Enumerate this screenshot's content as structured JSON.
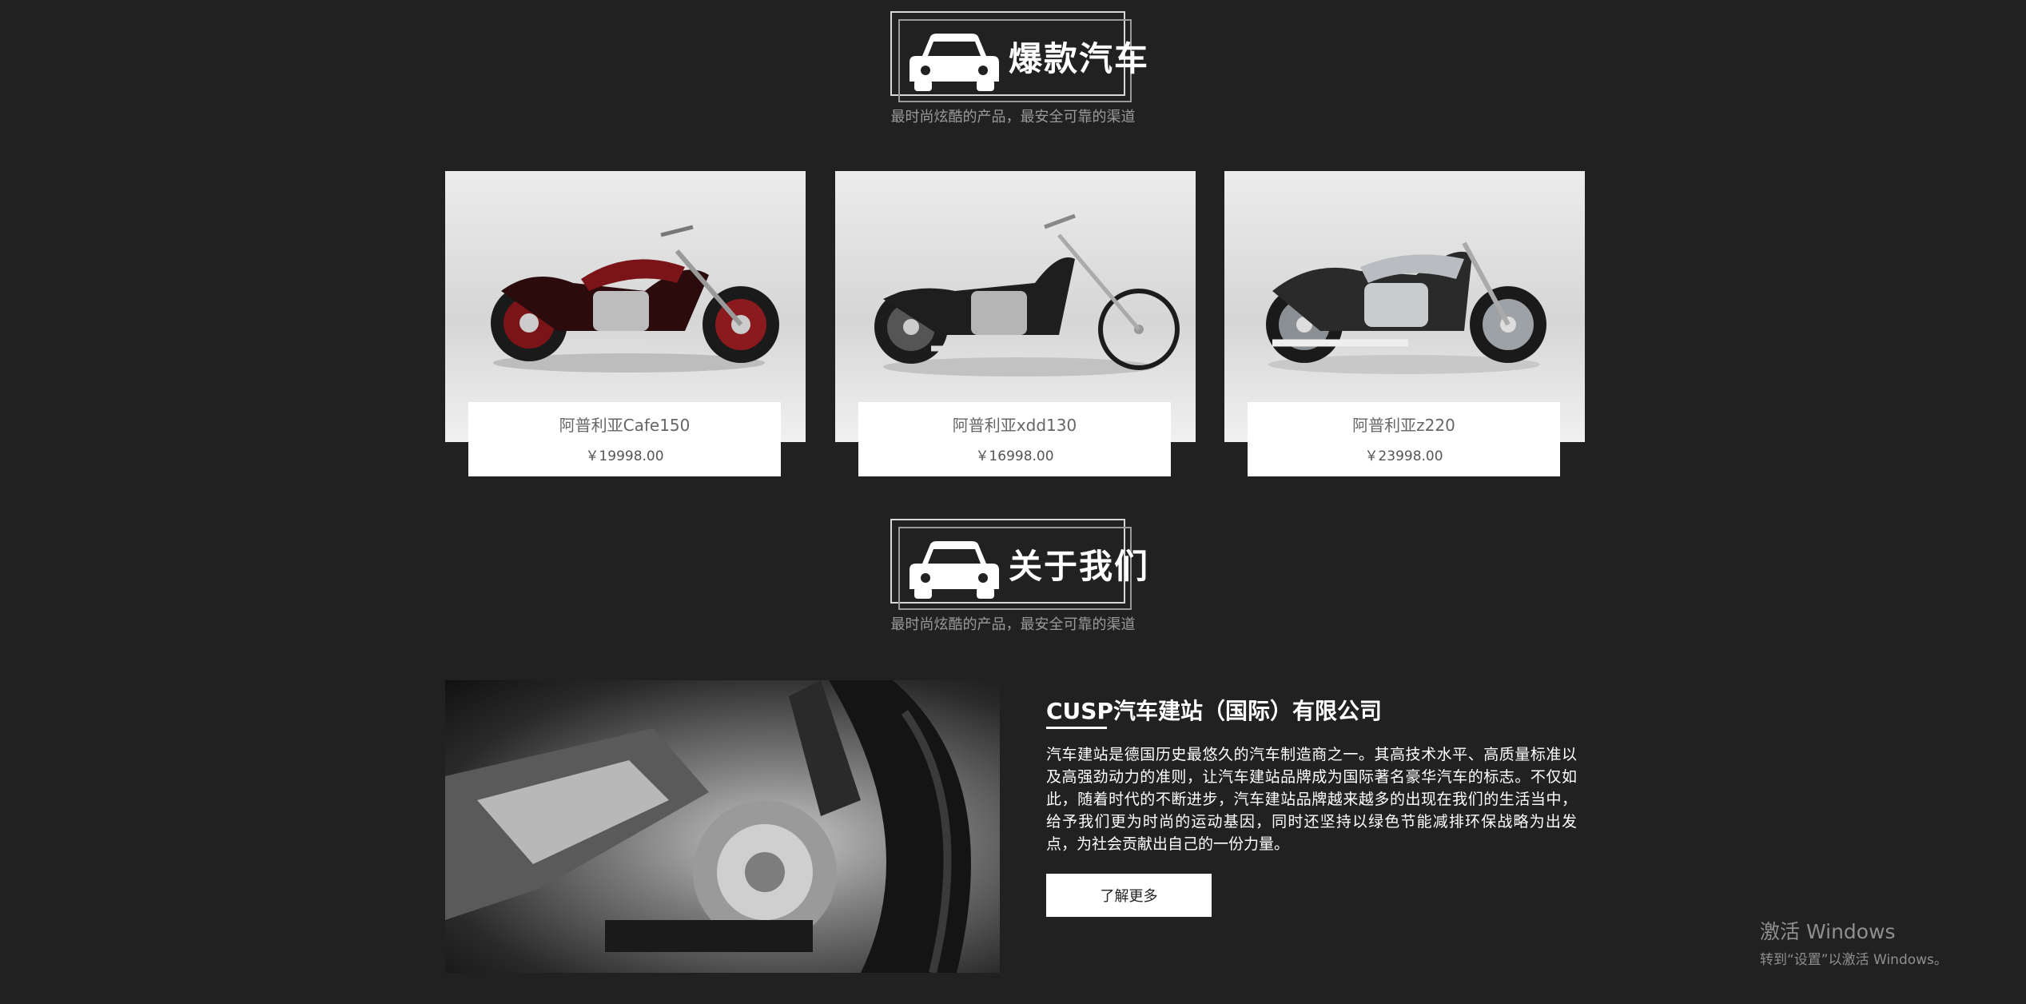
{
  "hot_section": {
    "title": "爆款汽车",
    "subtitle": "最时尚炫酷的产品，最安全可靠的渠道"
  },
  "products": [
    {
      "name": "阿普利亚Cafe150",
      "price": "￥19998.00",
      "accent": "#7a1418"
    },
    {
      "name": "阿普利亚xdd130",
      "price": "￥16998.00",
      "accent": "#1e1e1e"
    },
    {
      "name": "阿普利亚z220",
      "price": "￥23998.00",
      "accent": "#9da2a6"
    }
  ],
  "about_section": {
    "title": "关于我们",
    "subtitle": "最时尚炫酷的产品，最安全可靠的渠道",
    "company": "CUSP汽车建站（国际）有限公司",
    "description": "汽车建站是德国历史最悠久的汽车制造商之一。其高技术水平、高质量标准以及高强劲动力的准则，让汽车建站品牌成为国际著名豪华汽车的标志。不仅如此，随着时代的不断进步，汽车建站品牌越来越多的出现在我们的生活当中，给予我们更为时尚的运动基因，同时还坚持以绿色节能减排环保战略为出发点，为社会贡献出自己的一份力量。",
    "button_label": "了解更多"
  },
  "watermark": {
    "title": "激活 Windows",
    "subtitle": "转到“设置”以激活 Windows。"
  },
  "icons": {
    "section": "car-icon"
  },
  "colors": {
    "background": "#212121",
    "card": "#ffffff",
    "muted": "#9a9a9a"
  }
}
